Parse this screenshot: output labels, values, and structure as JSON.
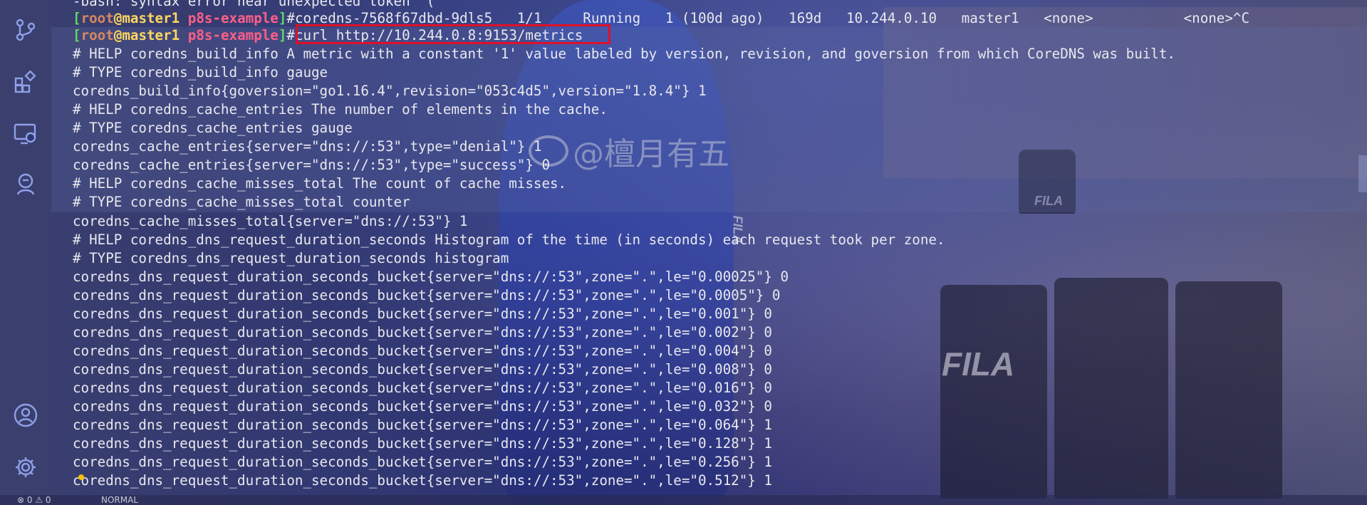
{
  "colors": {
    "highlight_border": "#e0102a",
    "prompt_bracket": "#5fd75f",
    "prompt_user": "#d7875f",
    "prompt_host": "#ffd75f",
    "prompt_dir": "#ff5f87",
    "text": "#e8e8ee"
  },
  "activity_bar": {
    "icons": [
      "source-control-icon",
      "extensions-icon",
      "remote-explorer-icon",
      "account-help-icon",
      "accounts-icon",
      "settings-gear-icon"
    ]
  },
  "watermark": {
    "text": "@檀月有五"
  },
  "background_logos": [
    "FILA",
    "FILA",
    "FILA"
  ],
  "terminal": {
    "line0": "-bash: syntax error near unexpected token `('",
    "line1": {
      "prompt_open": "[",
      "user": "root",
      "at": "@",
      "host": "master1",
      "dir": "p8s-example",
      "prompt_close": "]",
      "hash": "#",
      "text": "coredns-7568f67dbd-9dls5   1/1     Running   1 (100d ago)   169d   10.244.0.10   master1   <none>           <none>^C"
    },
    "line2": {
      "prompt_open": "[",
      "user": "root",
      "at": "@",
      "host": "master1",
      "dir": "p8s-example",
      "prompt_close": "]",
      "hash": "#",
      "command": "curl http://10.244.0.8:9153/metrics"
    },
    "output": [
      "# HELP coredns_build_info A metric with a constant '1' value labeled by version, revision, and goversion from which CoreDNS was built.",
      "# TYPE coredns_build_info gauge",
      "coredns_build_info{goversion=\"go1.16.4\",revision=\"053c4d5\",version=\"1.8.4\"} 1",
      "# HELP coredns_cache_entries The number of elements in the cache.",
      "# TYPE coredns_cache_entries gauge",
      "coredns_cache_entries{server=\"dns://:53\",type=\"denial\"} 1",
      "coredns_cache_entries{server=\"dns://:53\",type=\"success\"} 0",
      "# HELP coredns_cache_misses_total The count of cache misses.",
      "# TYPE coredns_cache_misses_total counter",
      "coredns_cache_misses_total{server=\"dns://:53\"} 1",
      "# HELP coredns_dns_request_duration_seconds Histogram of the time (in seconds) each request took per zone.",
      "# TYPE coredns_dns_request_duration_seconds histogram",
      "coredns_dns_request_duration_seconds_bucket{server=\"dns://:53\",zone=\".\",le=\"0.00025\"} 0",
      "coredns_dns_request_duration_seconds_bucket{server=\"dns://:53\",zone=\".\",le=\"0.0005\"} 0",
      "coredns_dns_request_duration_seconds_bucket{server=\"dns://:53\",zone=\".\",le=\"0.001\"} 0",
      "coredns_dns_request_duration_seconds_bucket{server=\"dns://:53\",zone=\".\",le=\"0.002\"} 0",
      "coredns_dns_request_duration_seconds_bucket{server=\"dns://:53\",zone=\".\",le=\"0.004\"} 0",
      "coredns_dns_request_duration_seconds_bucket{server=\"dns://:53\",zone=\".\",le=\"0.008\"} 0",
      "coredns_dns_request_duration_seconds_bucket{server=\"dns://:53\",zone=\".\",le=\"0.016\"} 0",
      "coredns_dns_request_duration_seconds_bucket{server=\"dns://:53\",zone=\".\",le=\"0.032\"} 0",
      "coredns_dns_request_duration_seconds_bucket{server=\"dns://:53\",zone=\".\",le=\"0.064\"} 1",
      "coredns_dns_request_duration_seconds_bucket{server=\"dns://:53\",zone=\".\",le=\"0.128\"} 1",
      "coredns_dns_request_duration_seconds_bucket{server=\"dns://:53\",zone=\".\",le=\"0.256\"} 1",
      "coredns_dns_request_duration_seconds_bucket{server=\"dns://:53\",zone=\".\",le=\"0.512\"} 1"
    ]
  },
  "status_bar": {
    "problems": "⊗ 0 ⚠ 0",
    "mode": "NORMAL"
  }
}
